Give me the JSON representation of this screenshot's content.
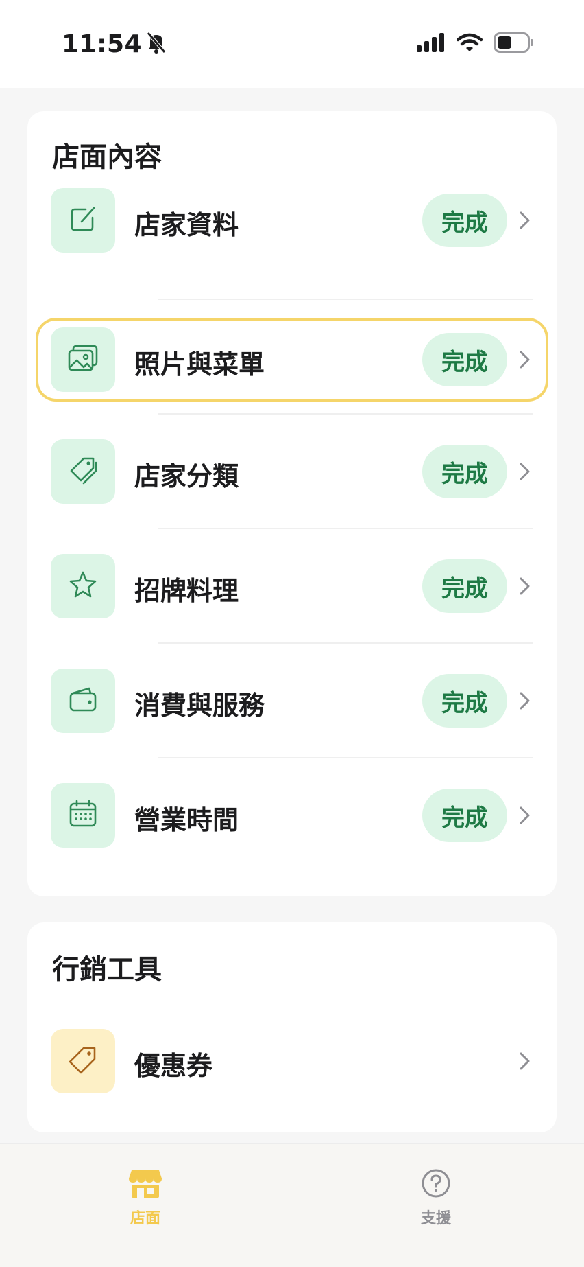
{
  "status_bar": {
    "time": "11:54"
  },
  "sections": {
    "content": {
      "title": "店面內容",
      "items": [
        {
          "label": "店家資料",
          "status": "完成",
          "icon": "edit-icon"
        },
        {
          "label": "照片與菜單",
          "status": "完成",
          "icon": "photo-icon"
        },
        {
          "label": "店家分類",
          "status": "完成",
          "icon": "tag-icon"
        },
        {
          "label": "招牌料理",
          "status": "完成",
          "icon": "star-icon"
        },
        {
          "label": "消費與服務",
          "status": "完成",
          "icon": "wallet-icon"
        },
        {
          "label": "營業時間",
          "status": "完成",
          "icon": "calendar-icon"
        }
      ]
    },
    "marketing": {
      "title": "行銷工具",
      "items": [
        {
          "label": "優惠券",
          "icon": "coupon-icon"
        }
      ]
    }
  },
  "tab_bar": {
    "tabs": [
      {
        "label": "店面",
        "icon": "store-icon",
        "active": true
      },
      {
        "label": "支援",
        "icon": "help-icon",
        "active": false
      }
    ]
  },
  "colors": {
    "accent_green": "#1e7a45",
    "badge_bg": "#dcf5e6",
    "highlight": "#f5d56a",
    "active_tab": "#f3c94d"
  }
}
